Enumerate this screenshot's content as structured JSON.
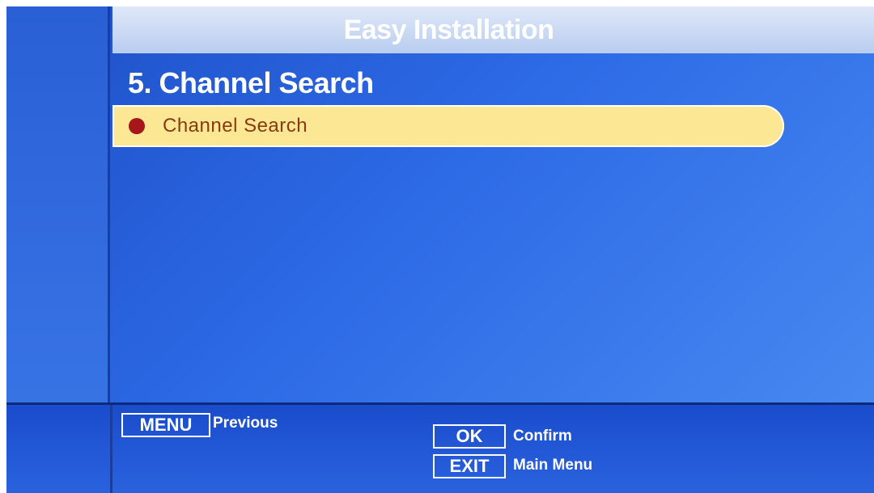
{
  "header": {
    "title": "Easy Installation"
  },
  "section": {
    "title": "5. Channel Search"
  },
  "menu": {
    "items": [
      {
        "label": "Channel Search",
        "selected": true
      }
    ]
  },
  "footer": {
    "keys": [
      {
        "key": "MENU",
        "description": "Previous"
      },
      {
        "key": "OK",
        "description": "Confirm"
      },
      {
        "key": "EXIT",
        "description": "Main Menu"
      }
    ]
  },
  "colors": {
    "background": "#2d6ae6",
    "header_bar": "#c9d8f3",
    "highlight": "#fbe794",
    "bullet": "#a6161a"
  },
  "icons": {
    "bullet": "bullet-dot-icon"
  }
}
